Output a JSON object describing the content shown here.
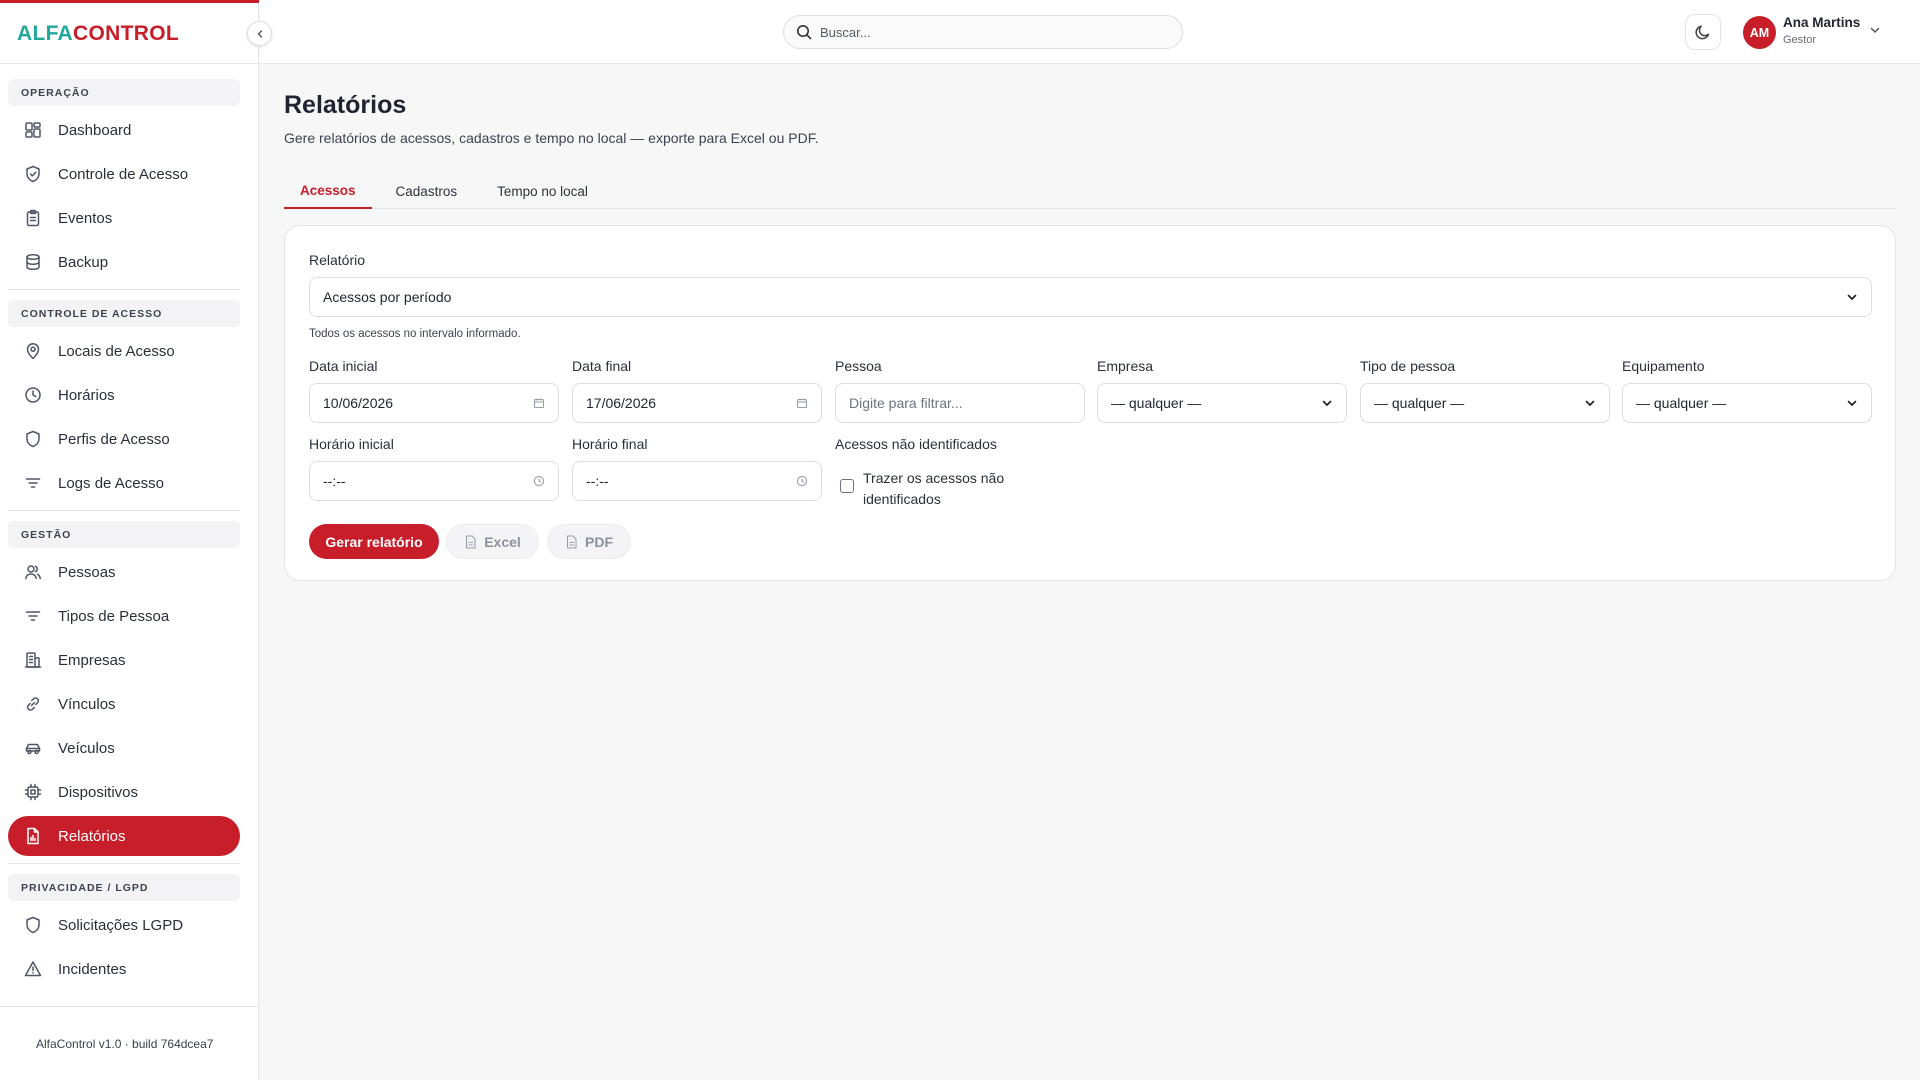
{
  "brand": {
    "part1": "ALFA",
    "part2": "CONTROL"
  },
  "sidebar": {
    "sections": [
      {
        "label": "OPERAÇÃO",
        "items": [
          {
            "label": "Dashboard",
            "icon": "dashboard-icon"
          },
          {
            "label": "Controle de Acesso",
            "icon": "shield-check-icon"
          },
          {
            "label": "Eventos",
            "icon": "clipboard-icon"
          },
          {
            "label": "Backup",
            "icon": "database-icon"
          }
        ]
      },
      {
        "label": "CONTROLE DE ACESSO",
        "items": [
          {
            "label": "Locais de Acesso",
            "icon": "map-pin-icon"
          },
          {
            "label": "Horários",
            "icon": "clock-icon"
          },
          {
            "label": "Perfis de Acesso",
            "icon": "shield-icon"
          },
          {
            "label": "Logs de Acesso",
            "icon": "filter-lines-icon"
          }
        ]
      },
      {
        "label": "GESTÃO",
        "items": [
          {
            "label": "Pessoas",
            "icon": "users-icon"
          },
          {
            "label": "Tipos de Pessoa",
            "icon": "filter-lines-icon"
          },
          {
            "label": "Empresas",
            "icon": "building-icon"
          },
          {
            "label": "Vínculos",
            "icon": "link-icon"
          },
          {
            "label": "Veículos",
            "icon": "car-icon"
          },
          {
            "label": "Dispositivos",
            "icon": "chip-icon"
          },
          {
            "label": "Relatórios",
            "icon": "report-icon",
            "active": true
          }
        ]
      },
      {
        "label": "PRIVACIDADE / LGPD",
        "items": [
          {
            "label": "Solicitações LGPD",
            "icon": "shield-icon"
          },
          {
            "label": "Incidentes",
            "icon": "alert-triangle-icon"
          }
        ]
      }
    ],
    "version": "AlfaControl v1.0 · build 764dcea7"
  },
  "header": {
    "search_placeholder": "Buscar...",
    "user": {
      "initials": "AM",
      "name": "Ana Martins",
      "role": "Gestor"
    }
  },
  "page": {
    "title": "Relatórios",
    "subtitle": "Gere relatórios de acessos, cadastros e tempo no local — exporte para Excel ou PDF.",
    "tabs": [
      "Acessos",
      "Cadastros",
      "Tempo no local"
    ],
    "active_tab": 0
  },
  "form": {
    "report_label": "Relatório",
    "report_value": "Acessos por período",
    "report_hint": "Todos os acessos no intervalo informado.",
    "start_date_label": "Data inicial",
    "start_date_value": "10/06/2026",
    "end_date_label": "Data final",
    "end_date_value": "17/06/2026",
    "person_label": "Pessoa",
    "person_placeholder": "Digite para filtrar...",
    "company_label": "Empresa",
    "company_value": "— qualquer —",
    "person_type_label": "Tipo de pessoa",
    "person_type_value": "— qualquer —",
    "equipment_label": "Equipamento",
    "equipment_value": "— qualquer —",
    "start_time_label": "Horário inicial",
    "start_time_value": "--:--",
    "end_time_label": "Horário final",
    "end_time_value": "--:--",
    "unidentified_label": "Acessos não identificados",
    "unidentified_checkbox_label": "Trazer os acessos não identificados",
    "unidentified_checked": false,
    "generate_button": "Gerar relatório",
    "excel_button": "Excel",
    "pdf_button": "PDF"
  },
  "colors": {
    "accent": "#c81e2a",
    "brand_teal": "#22a89b"
  }
}
